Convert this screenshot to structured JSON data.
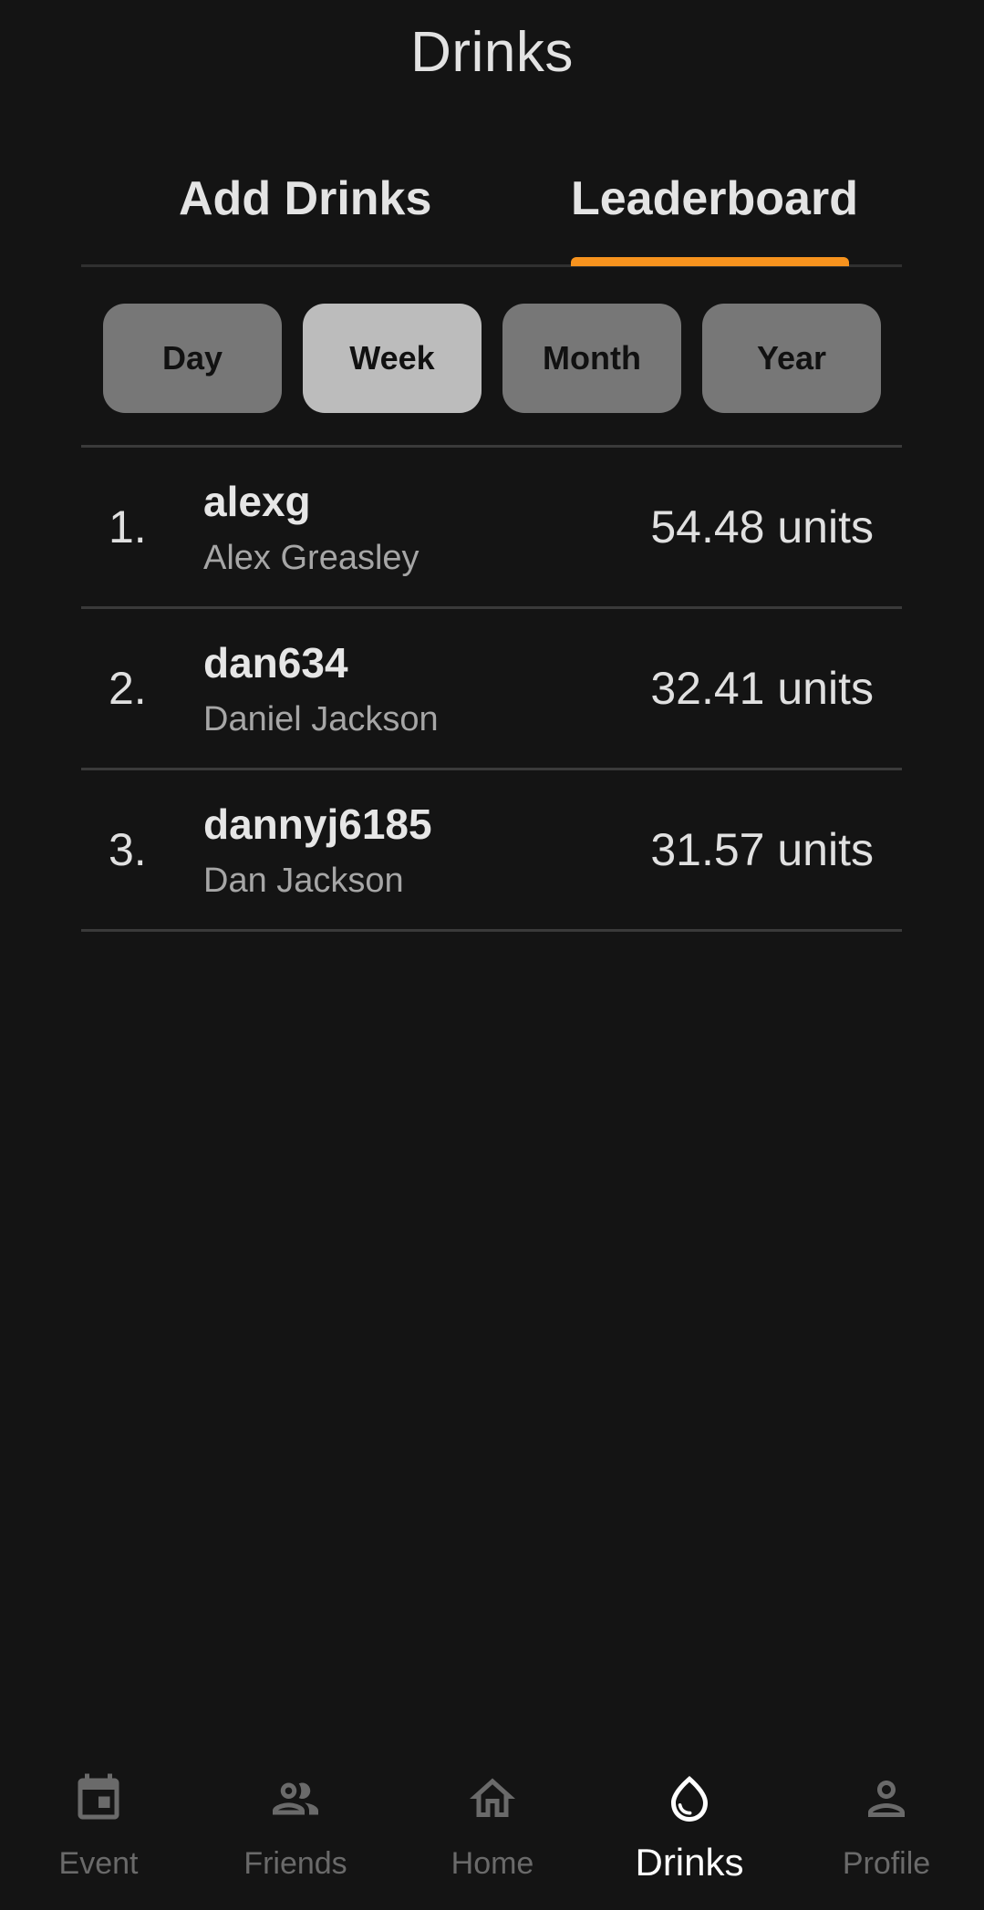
{
  "header": {
    "title": "Drinks"
  },
  "tabs": {
    "add_drinks": "Add Drinks",
    "leaderboard": "Leaderboard",
    "active": "Leaderboard"
  },
  "filters": {
    "items": [
      "Day",
      "Week",
      "Month",
      "Year"
    ],
    "selected": "Week"
  },
  "leaderboard": {
    "rows": [
      {
        "rank": "1.",
        "username": "alexg",
        "name": "Alex Greasley",
        "units": "54.48 units"
      },
      {
        "rank": "2.",
        "username": "dan634",
        "name": "Daniel Jackson",
        "units": "32.41 units"
      },
      {
        "rank": "3.",
        "username": "dannyj6185",
        "name": "Dan Jackson",
        "units": "31.57 units"
      }
    ]
  },
  "nav": {
    "items": [
      {
        "label": "Event",
        "icon": "calendar-icon"
      },
      {
        "label": "Friends",
        "icon": "people-icon"
      },
      {
        "label": "Home",
        "icon": "home-icon"
      },
      {
        "label": "Drinks",
        "icon": "water-drop-icon"
      },
      {
        "label": "Profile",
        "icon": "person-icon"
      }
    ],
    "active": "Drinks"
  },
  "colors": {
    "background": "#141414",
    "accent": "#f7931e",
    "filter_button": "#777777",
    "filter_button_active": "#bcbcbc",
    "nav_inactive": "#6a6a6a",
    "nav_active": "#ffffff"
  }
}
